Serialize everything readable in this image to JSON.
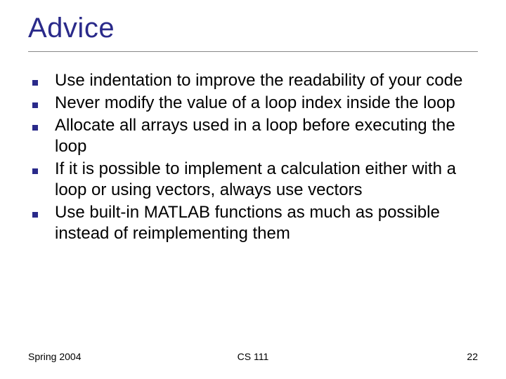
{
  "title": "Advice",
  "bullets": [
    "Use indentation to improve the readability of your code",
    "Never modify the value of a loop index inside the loop",
    "Allocate all arrays used in a loop before executing the loop",
    "If it is possible to implement a calculation either with a loop or using vectors, always use vectors",
    "Use built-in MATLAB functions as much as possible instead of reimplementing them"
  ],
  "footer": {
    "left": "Spring 2004",
    "center": "CS 111",
    "right": "22"
  }
}
